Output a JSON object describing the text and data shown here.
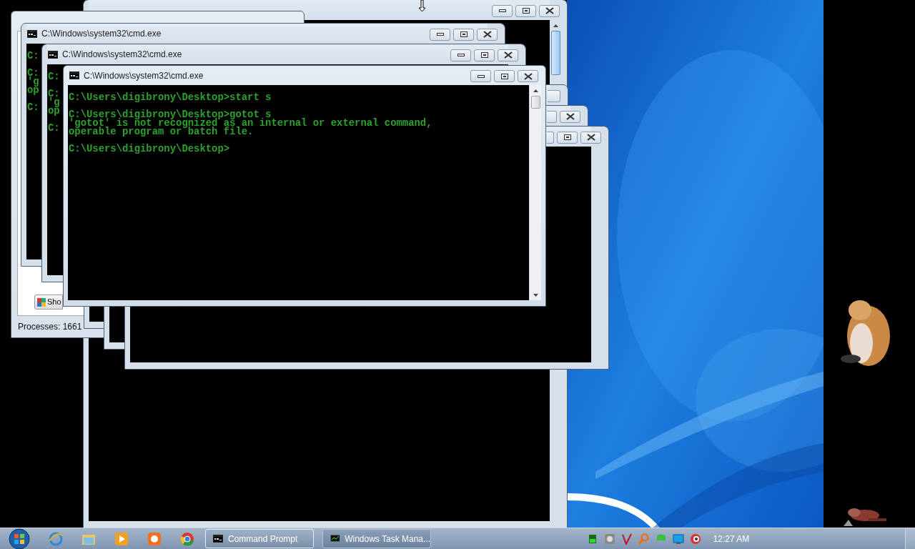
{
  "windows": [
    {
      "kind": "console"
    },
    {
      "kind": "console",
      "title": "C:\\Windows\\system32\\cmd.exe",
      "lines": [
        {
          "kind": "text",
          "text": "C:"
        },
        {
          "kind": "blank"
        },
        {
          "kind": "text",
          "text": "C:"
        },
        {
          "kind": "text",
          "text": "'g"
        },
        {
          "kind": "text",
          "text": "op"
        },
        {
          "kind": "blank"
        },
        {
          "kind": "text",
          "text": "C:"
        }
      ]
    },
    {
      "kind": "console",
      "title": "C:\\Windows\\system32\\cmd.exe",
      "lines": [
        {
          "kind": "text",
          "text": "C:"
        },
        {
          "kind": "blank"
        },
        {
          "kind": "text",
          "text": "C:"
        },
        {
          "kind": "text",
          "text": "'g"
        },
        {
          "kind": "text",
          "text": "op"
        },
        {
          "kind": "blank"
        },
        {
          "kind": "text",
          "text": "C:"
        }
      ]
    },
    {
      "kind": "console",
      "title": "C:\\Windows\\system32\\cmd.exe",
      "lines": [
        {
          "kind": "text",
          "text": "C:\\Users\\digibrony\\Desktop>start s"
        },
        {
          "kind": "blank"
        },
        {
          "kind": "text",
          "text": "C:\\Users\\digibrony\\Desktop>gotot s"
        },
        {
          "kind": "text",
          "text": "'gotot' is not recognized as an internal or external command,"
        },
        {
          "kind": "text",
          "text": "operable program or batch file."
        },
        {
          "kind": "blank"
        },
        {
          "kind": "text",
          "text": "C:\\Users\\digibrony\\Desktop>"
        }
      ]
    },
    {
      "kind": "console"
    },
    {
      "kind": "console"
    },
    {
      "kind": "console"
    },
    {
      "kind": "task_manager",
      "button": "Sho",
      "status": "Processes: 1661"
    }
  ],
  "taskbar": {
    "tasks": [
      {
        "label": "Command Prompt",
        "selected": true
      },
      {
        "label": "Windows Task Mana...",
        "selected": false
      }
    ],
    "clock": "12:27 AM"
  }
}
